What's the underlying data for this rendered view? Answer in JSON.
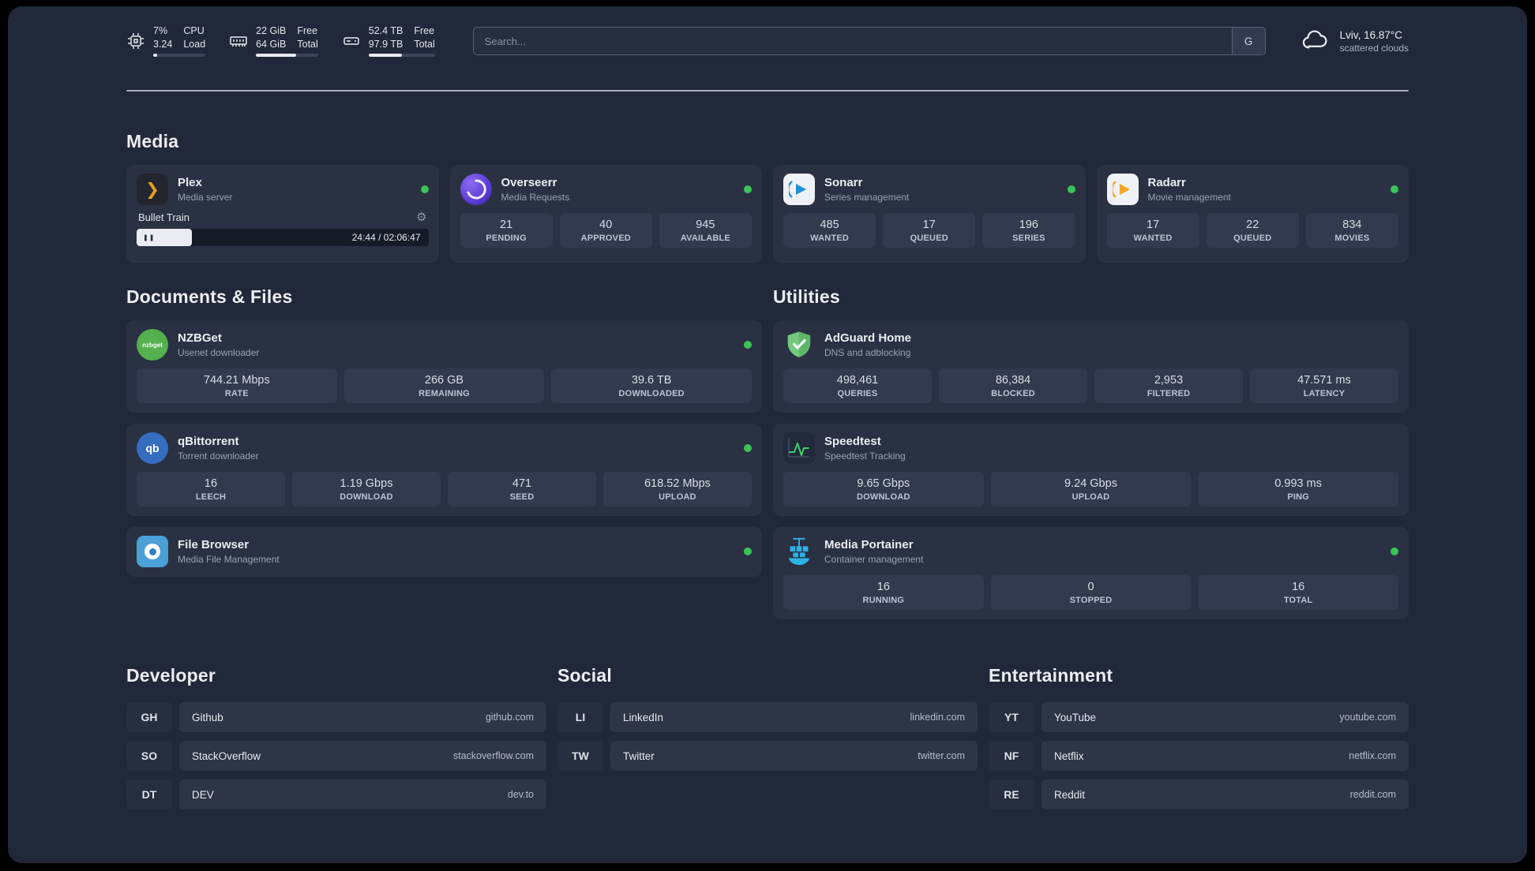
{
  "topbar": {
    "cpu": {
      "value1": "7%",
      "value2": "3.24",
      "label1": "CPU",
      "label2": "Load"
    },
    "ram": {
      "value1": "22 GiB",
      "value2": "64 GiB",
      "label1": "Free",
      "label2": "Total"
    },
    "disk": {
      "value1": "52.4 TB",
      "value2": "97.9 TB",
      "label1": "Free",
      "label2": "Total"
    },
    "search": {
      "placeholder": "Search...",
      "button_label": "G"
    },
    "weather": {
      "location": "Lviv, 16.87°C",
      "condition": "scattered clouds"
    }
  },
  "media": {
    "title": "Media",
    "plex": {
      "name": "Plex",
      "subtitle": "Media server",
      "now_playing": "Bullet Train",
      "time": "24:44 / 02:06:47"
    },
    "overseerr": {
      "name": "Overseerr",
      "subtitle": "Media Requests",
      "stats": [
        {
          "value": "21",
          "label": "PENDING"
        },
        {
          "value": "40",
          "label": "APPROVED"
        },
        {
          "value": "945",
          "label": "AVAILABLE"
        }
      ]
    },
    "sonarr": {
      "name": "Sonarr",
      "subtitle": "Series management",
      "stats": [
        {
          "value": "485",
          "label": "WANTED"
        },
        {
          "value": "17",
          "label": "QUEUED"
        },
        {
          "value": "196",
          "label": "SERIES"
        }
      ]
    },
    "radarr": {
      "name": "Radarr",
      "subtitle": "Movie management",
      "stats": [
        {
          "value": "17",
          "label": "WANTED"
        },
        {
          "value": "22",
          "label": "QUEUED"
        },
        {
          "value": "834",
          "label": "MOVIES"
        }
      ]
    }
  },
  "documents": {
    "title": "Documents & Files",
    "nzbget": {
      "name": "NZBGet",
      "subtitle": "Usenet downloader",
      "stats": [
        {
          "value": "744.21 Mbps",
          "label": "RATE"
        },
        {
          "value": "266 GB",
          "label": "REMAINING"
        },
        {
          "value": "39.6 TB",
          "label": "DOWNLOADED"
        }
      ]
    },
    "qbittorrent": {
      "name": "qBittorrent",
      "subtitle": "Torrent downloader",
      "stats": [
        {
          "value": "16",
          "label": "LEECH"
        },
        {
          "value": "1.19 Gbps",
          "label": "DOWNLOAD"
        },
        {
          "value": "471",
          "label": "SEED"
        },
        {
          "value": "618.52 Mbps",
          "label": "UPLOAD"
        }
      ]
    },
    "filebrowser": {
      "name": "File Browser",
      "subtitle": "Media File Management"
    }
  },
  "utilities": {
    "title": "Utilities",
    "adguard": {
      "name": "AdGuard Home",
      "subtitle": "DNS and adblocking",
      "stats": [
        {
          "value": "498,461",
          "label": "QUERIES"
        },
        {
          "value": "86,384",
          "label": "BLOCKED"
        },
        {
          "value": "2,953",
          "label": "FILTERED"
        },
        {
          "value": "47.571 ms",
          "label": "LATENCY"
        }
      ]
    },
    "speedtest": {
      "name": "Speedtest",
      "subtitle": "Speedtest Tracking",
      "stats": [
        {
          "value": "9.65 Gbps",
          "label": "DOWNLOAD"
        },
        {
          "value": "9.24 Gbps",
          "label": "UPLOAD"
        },
        {
          "value": "0.993 ms",
          "label": "PING"
        }
      ]
    },
    "portainer": {
      "name": "Media Portainer",
      "subtitle": "Container management",
      "stats": [
        {
          "value": "16",
          "label": "RUNNING"
        },
        {
          "value": "0",
          "label": "STOPPED"
        },
        {
          "value": "16",
          "label": "TOTAL"
        }
      ]
    }
  },
  "bookmarks": {
    "developer": {
      "title": "Developer",
      "items": [
        {
          "abbr": "GH",
          "name": "Github",
          "url": "github.com"
        },
        {
          "abbr": "SO",
          "name": "StackOverflow",
          "url": "stackoverflow.com"
        },
        {
          "abbr": "DT",
          "name": "DEV",
          "url": "dev.to"
        }
      ]
    },
    "social": {
      "title": "Social",
      "items": [
        {
          "abbr": "LI",
          "name": "LinkedIn",
          "url": "linkedin.com"
        },
        {
          "abbr": "TW",
          "name": "Twitter",
          "url": "twitter.com"
        }
      ]
    },
    "entertainment": {
      "title": "Entertainment",
      "items": [
        {
          "abbr": "YT",
          "name": "YouTube",
          "url": "youtube.com"
        },
        {
          "abbr": "NF",
          "name": "Netflix",
          "url": "netflix.com"
        },
        {
          "abbr": "RE",
          "name": "Reddit",
          "url": "reddit.com"
        }
      ]
    }
  },
  "icons": {
    "plex_chevron": "❯",
    "nzbget_text": "nzbget",
    "qbittorrent_text": "qb",
    "gear": "⚙",
    "pause": "❚❚"
  },
  "colors": {
    "status_ok": "#3bc455",
    "accent_orange": "#e8a117",
    "accent_purple": "#5b3bd6",
    "accent_blue": "#2fb2e6",
    "accent_green": "#54b14e"
  }
}
